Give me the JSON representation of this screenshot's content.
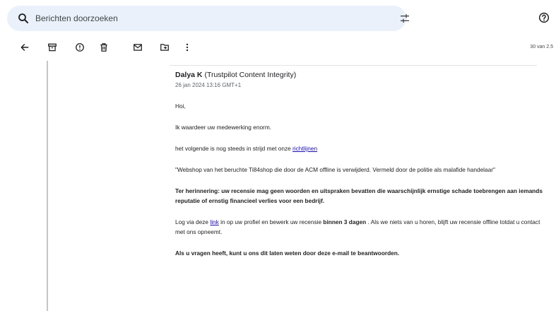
{
  "search": {
    "placeholder": "Berichten doorzoeken"
  },
  "toolbar": {
    "pager": "30 van 2.5"
  },
  "email": {
    "sender_name": "Dalya K",
    "sender_org": "(Trustpilot Content Integrity)",
    "timestamp": "26 jan 2024 13:16 GMT+1",
    "greeting": "Hoi,",
    "para1": "Ik waardeer uw medewerking enorm.",
    "para2_prefix": "het volgende is nog steeds in strijd met onze ",
    "para2_link": "richtlijnen",
    "para3": "\"Webshop van het beruchte Ti84shop die door de ACM offline is verwijderd. Vermeld door de politie als malafide handelaar\"",
    "para4": "Ter herinnering: uw recensie mag geen woorden en uitspraken bevatten die waarschijnlijk ernstige schade toebrengen aan iemands reputatie of ernstig financieel verlies voor een bedrijf.",
    "para5_a": "Log via deze ",
    "para5_link": "link",
    "para5_b": " in op uw profiel en bewerk uw recensie ",
    "para5_bold": "binnen 3 dagen",
    "para5_c": " . Als we niets van u horen, blijft uw recensie offline totdat u contact met ons opneemt.",
    "para6": "Als u vragen heeft, kunt u ons dit laten weten door deze e-mail te beantwoorden."
  }
}
